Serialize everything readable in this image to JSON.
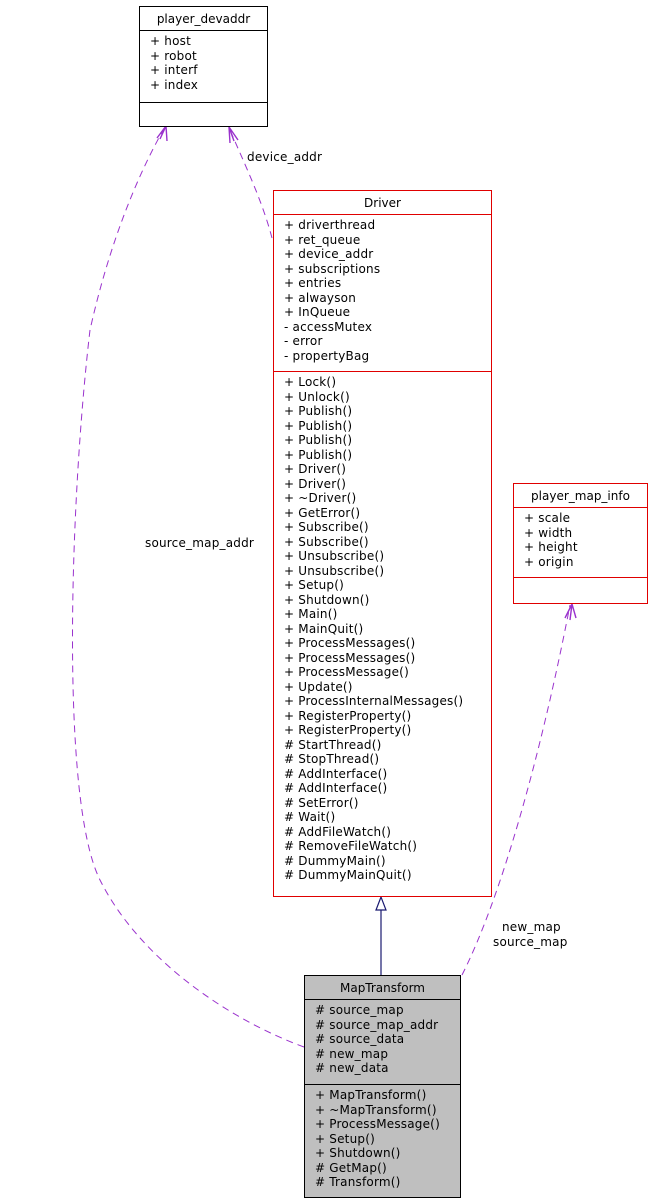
{
  "diagram": {
    "type": "uml-collaboration",
    "colors": {
      "usage_edge": "#9a32cd",
      "inheritance_edge": "#191970",
      "documented_border": "#e00000",
      "undocumented_border": "#000000",
      "focus_fill": "#bfbfbf"
    },
    "classes": {
      "player_devaddr": {
        "name": "player_devaddr",
        "attributes": [
          "+ host",
          "+ robot",
          "+ interf",
          "+ index"
        ],
        "methods": []
      },
      "driver": {
        "name": "Driver",
        "attributes": [
          "+ driverthread",
          "+ ret_queue",
          "+ device_addr",
          "+ subscriptions",
          "+ entries",
          "+ alwayson",
          "+ InQueue",
          "- accessMutex",
          "- error",
          "- propertyBag"
        ],
        "methods": [
          "+ Lock()",
          "+ Unlock()",
          "+ Publish()",
          "+ Publish()",
          "+ Publish()",
          "+ Publish()",
          "+ Driver()",
          "+ Driver()",
          "+ ~Driver()",
          "+ GetError()",
          "+ Subscribe()",
          "+ Subscribe()",
          "+ Unsubscribe()",
          "+ Unsubscribe()",
          "+ Setup()",
          "+ Shutdown()",
          "+ Main()",
          "+ MainQuit()",
          "+ ProcessMessages()",
          "+ ProcessMessages()",
          "+ ProcessMessage()",
          "+ Update()",
          "+ ProcessInternalMessages()",
          "+ RegisterProperty()",
          "+ RegisterProperty()",
          "# StartThread()",
          "# StopThread()",
          "# AddInterface()",
          "# AddInterface()",
          "# SetError()",
          "# Wait()",
          "# AddFileWatch()",
          "# RemoveFileWatch()",
          "# DummyMain()",
          "# DummyMainQuit()"
        ]
      },
      "player_map_info": {
        "name": "player_map_info",
        "attributes": [
          "+ scale",
          "+ width",
          "+ height",
          "+ origin"
        ],
        "methods": []
      },
      "map_transform": {
        "name": "MapTransform",
        "attributes": [
          "# source_map",
          "# source_map_addr",
          "# source_data",
          "# new_map",
          "# new_data"
        ],
        "methods": [
          "+ MapTransform()",
          "+ ~MapTransform()",
          "+ ProcessMessage()",
          "+ Setup()",
          "+ Shutdown()",
          "# GetMap()",
          "# Transform()"
        ]
      }
    },
    "edges": [
      {
        "from": "Driver",
        "to": "player_devaddr",
        "kind": "usage",
        "label": "device_addr"
      },
      {
        "from": "MapTransform",
        "to": "player_devaddr",
        "kind": "usage",
        "label": "source_map_addr"
      },
      {
        "from": "MapTransform",
        "to": "player_map_info",
        "kind": "usage",
        "label_lines": [
          "new_map",
          "source_map"
        ]
      },
      {
        "from": "MapTransform",
        "to": "Driver",
        "kind": "inheritance",
        "label": ""
      }
    ]
  }
}
